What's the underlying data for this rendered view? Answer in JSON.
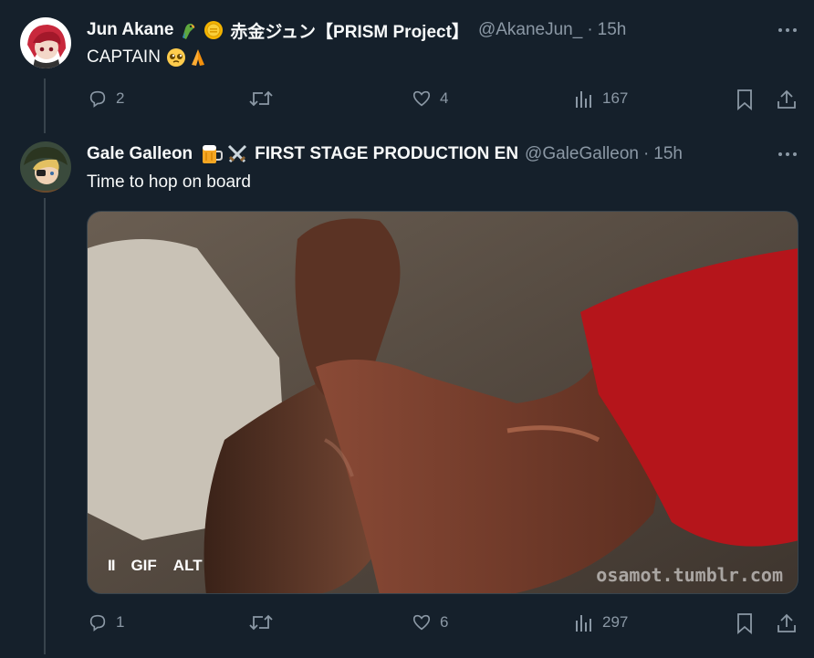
{
  "tweet1": {
    "name": "Jun Akane",
    "emoji_badges": [
      "parrot-emoji",
      "coin-emoji"
    ],
    "name_suffix": "赤金ジュン【PRISM Project】",
    "handle": "@AkaneJun_",
    "dot": "·",
    "time": "15h",
    "text": "CAPTAIN",
    "text_emojis": [
      "pleading-face-emoji",
      "folded-hands-emoji"
    ],
    "replies": "2",
    "retweets": "",
    "likes": "4",
    "views": "167"
  },
  "tweet2": {
    "name": "Gale Galleon",
    "emoji_badges": [
      "beer-mug-emoji",
      "crossed-swords-emoji"
    ],
    "name_suffix": "FIRST STAGE PRODUCTION EN",
    "handle": "@GaleGalleon",
    "dot": "·",
    "time": "15h",
    "text": "Time to hop on board",
    "media": {
      "pause_label": "II",
      "gif_label": "GIF",
      "alt_label": "ALT",
      "watermark": "osamot.tumblr.com"
    },
    "replies": "1",
    "retweets": "",
    "likes": "6",
    "views": "297"
  },
  "colors": {
    "background": "#15202b",
    "text_primary": "#f7f9f9",
    "text_secondary": "#8b98a5",
    "divider": "#38444d"
  },
  "icons": [
    "reply-icon",
    "retweet-icon",
    "like-icon",
    "views-icon",
    "bookmark-icon",
    "share-icon",
    "more-icon"
  ]
}
